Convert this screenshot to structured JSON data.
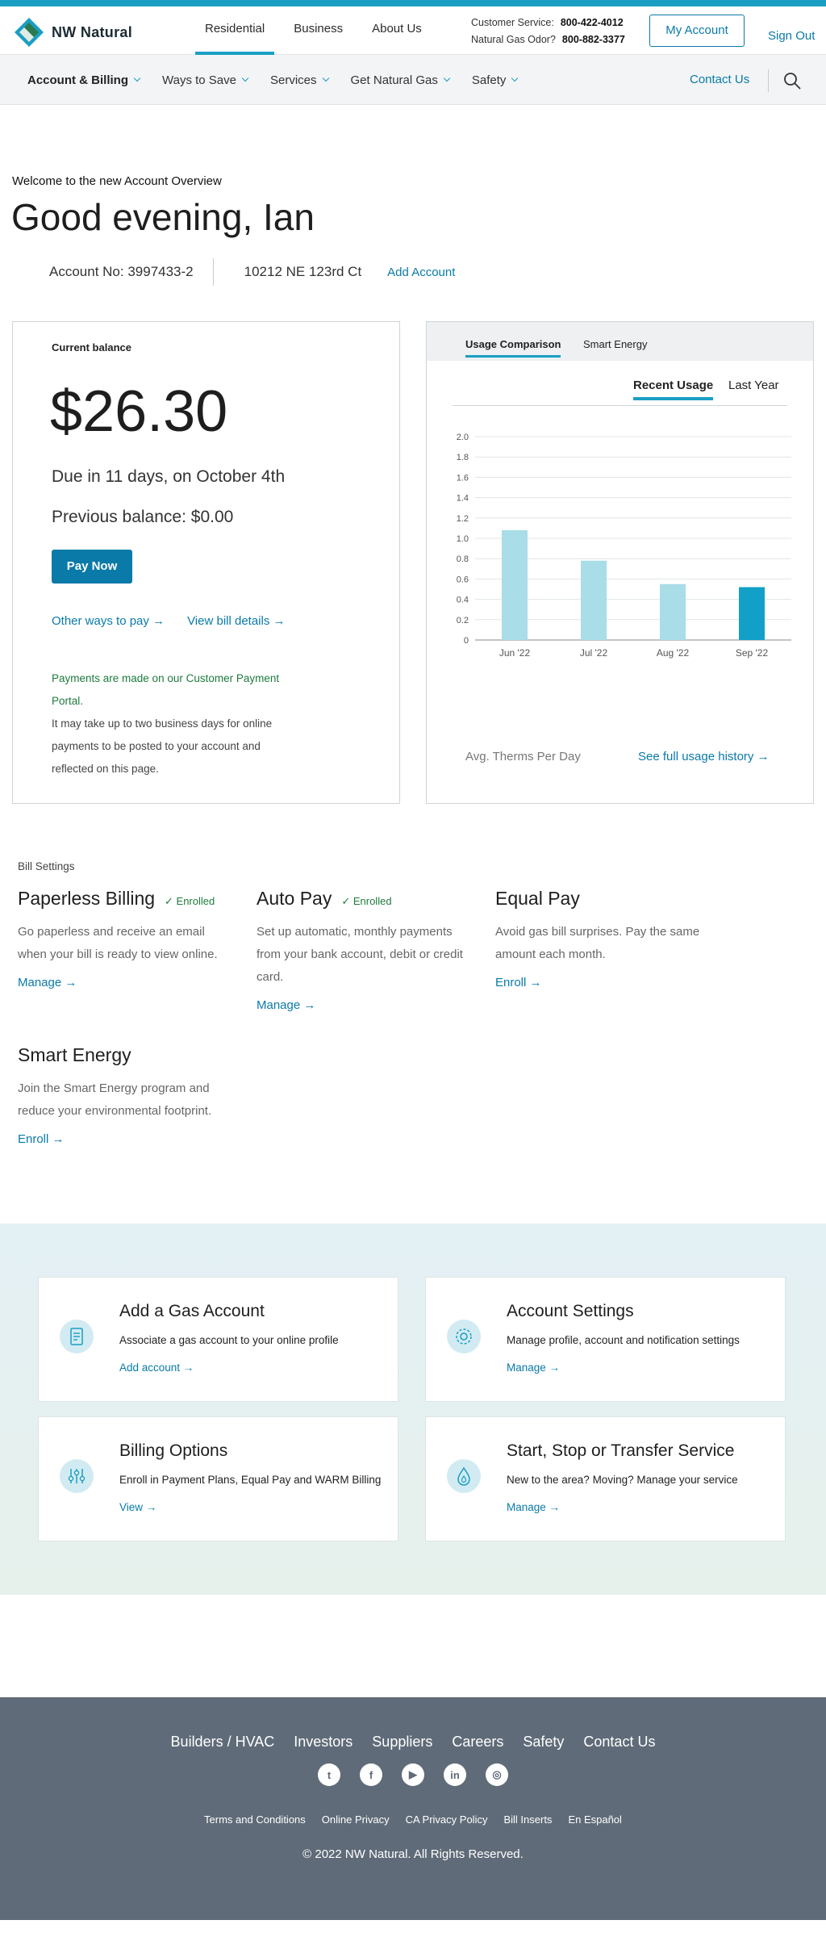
{
  "header": {
    "logo_text": "NW Natural",
    "nav": [
      "Residential",
      "Business",
      "About Us"
    ],
    "customer_service_label": "Customer Service:",
    "customer_service_phone": "800-422-4012",
    "gas_odor_label": "Natural Gas Odor?",
    "gas_odor_phone": "800-882-3377",
    "my_account": "My Account",
    "sign_out": "Sign Out"
  },
  "subnav": {
    "items": [
      "Account & Billing",
      "Ways to Save",
      "Services",
      "Get Natural Gas",
      "Safety"
    ],
    "contact": "Contact Us"
  },
  "overview": {
    "welcome": "Welcome to the new Account Overview",
    "greeting": "Good evening, Ian",
    "account_no": "Account No: 3997433-2",
    "address": "10212 NE 123rd Ct",
    "add_account": "Add Account"
  },
  "balance": {
    "label": "Current balance",
    "amount": "$26.30",
    "due": "Due in 11 days, on October 4th",
    "previous": "Previous balance: $0.00",
    "pay_now": "Pay Now",
    "other_ways": "Other ways to pay →",
    "view_bill": "View bill details →",
    "note_green": "Payments are made on our Customer Payment Portal.",
    "note": "It may take up to two business days for online payments to be posted to your account and reflected on this page."
  },
  "usage": {
    "tabs": [
      "Usage Comparison",
      "Smart Energy"
    ],
    "subtabs": [
      "Recent Usage",
      "Last Year"
    ],
    "footer_label": "Avg. Therms Per Day",
    "footer_link": "See full usage history →"
  },
  "chart_data": {
    "type": "bar",
    "categories": [
      "Jun '22",
      "Jul '22",
      "Aug '22",
      "Sep '22"
    ],
    "values": [
      1.08,
      0.78,
      0.55,
      0.52
    ],
    "ylim": [
      0,
      2.0
    ],
    "yticks": [
      "0",
      "0.2",
      "0.4",
      "0.6",
      "0.8",
      "1.0",
      "1.2",
      "1.4",
      "1.6",
      "1.8",
      "2.0"
    ],
    "colors": [
      "#a9dde8",
      "#a9dde8",
      "#a9dde8",
      "#12a0c8"
    ],
    "grid": true
  },
  "bill_settings": {
    "label": "Bill Settings",
    "items": [
      {
        "title": "Paperless Billing",
        "enrolled": "✓ Enrolled",
        "desc": "Go paperless and receive an email when your bill is ready to view online.",
        "link": "Manage →"
      },
      {
        "title": "Auto Pay",
        "enrolled": "✓ Enrolled",
        "desc": "Set up automatic, monthly payments from your bank account, debit or credit card.",
        "link": "Manage →"
      },
      {
        "title": "Equal Pay",
        "enrolled": "",
        "desc": "Avoid gas bill surprises. Pay the same amount each month.",
        "link": "Enroll →"
      },
      {
        "title": "Smart Energy",
        "enrolled": "",
        "desc": "Join the Smart Energy program and reduce your environmental footprint.",
        "link": "Enroll →"
      }
    ]
  },
  "tiles": [
    {
      "title": "Add a Gas Account",
      "desc": "Associate a gas account to your online profile",
      "link": "Add account →",
      "icon": "document-icon"
    },
    {
      "title": "Account Settings",
      "desc": "Manage profile, account and notification settings",
      "link": "Manage →",
      "icon": "gear-icon"
    },
    {
      "title": "Billing Options",
      "desc": "Enroll in Payment Plans, Equal Pay and WARM Billing",
      "link": "View →",
      "icon": "sliders-icon"
    },
    {
      "title": "Start, Stop or Transfer Service",
      "desc": "New to the area? Moving? Manage your service",
      "link": "Manage →",
      "icon": "flame-icon"
    }
  ],
  "footer": {
    "links": [
      "Builders / HVAC",
      "Investors",
      "Suppliers",
      "Careers",
      "Safety",
      "Contact Us"
    ],
    "social": [
      "twitter-icon",
      "facebook-icon",
      "youtube-icon",
      "linkedin-icon",
      "instagram-icon"
    ],
    "legal": [
      "Terms and Conditions",
      "Online Privacy",
      "CA Privacy Policy",
      "Bill Inserts",
      "En Español"
    ],
    "copyright": "© 2022 NW Natural. All Rights Reserved."
  },
  "colors": {
    "accent": "#1a9ec4",
    "link": "#0a7aa8",
    "success": "#1e7b3e",
    "footer": "#5f6b78"
  }
}
